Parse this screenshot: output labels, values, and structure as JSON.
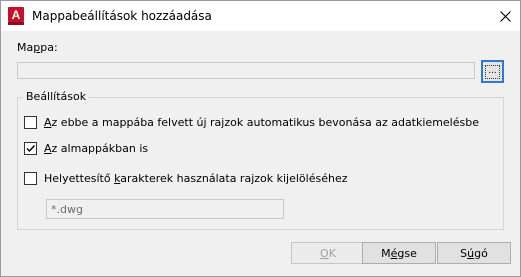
{
  "window": {
    "title": "Mappabeállítások hozzáadása",
    "app_icon_letter": "A",
    "app_icon_color": "#c8102e"
  },
  "folder": {
    "label_pre": "Ma",
    "label_key": "p",
    "label_post": "pa:",
    "value": "",
    "browse_label": "..."
  },
  "settings": {
    "group_label": "Beállítások",
    "options": [
      {
        "key": "A",
        "rest": "z ebbe a mappába felvett új rajzok automatikus bevonása az adatkiemelésbe",
        "pre": "",
        "checked": false
      },
      {
        "key": "A",
        "rest": "z almappákban is",
        "pre": "",
        "checked": true
      },
      {
        "key": "k",
        "rest": "arakterek használata rajzok kijelöléséhez",
        "pre": "Helyettesítő ",
        "checked": false
      }
    ],
    "wildcard_value": "*.dwg"
  },
  "buttons": {
    "ok": {
      "key": "O",
      "rest": "K",
      "enabled": false
    },
    "cancel": {
      "pre": "M",
      "key": "é",
      "rest": "gse"
    },
    "help": {
      "pre": "S",
      "key": "ú",
      "rest": "gó"
    }
  }
}
